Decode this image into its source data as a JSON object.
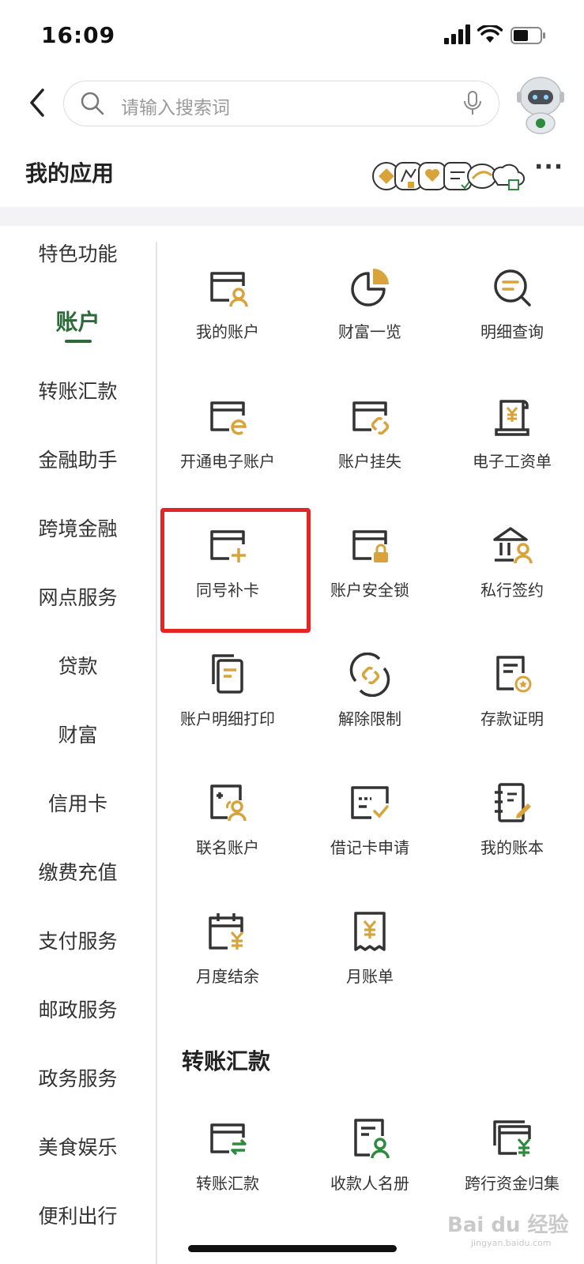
{
  "status_bar": {
    "time": "16:09"
  },
  "search": {
    "placeholder": "请输入搜索词"
  },
  "my_apps": {
    "title": "我的应用",
    "more": "···"
  },
  "sidebar": {
    "items": [
      {
        "label": "特色功能",
        "active": false
      },
      {
        "label": "账户",
        "active": true
      },
      {
        "label": "转账汇款",
        "active": false
      },
      {
        "label": "金融助手",
        "active": false
      },
      {
        "label": "跨境金融",
        "active": false
      },
      {
        "label": "网点服务",
        "active": false
      },
      {
        "label": "贷款",
        "active": false
      },
      {
        "label": "财富",
        "active": false
      },
      {
        "label": "信用卡",
        "active": false
      },
      {
        "label": "缴费充值",
        "active": false
      },
      {
        "label": "支付服务",
        "active": false
      },
      {
        "label": "邮政服务",
        "active": false
      },
      {
        "label": "政务服务",
        "active": false
      },
      {
        "label": "美食娱乐",
        "active": false
      },
      {
        "label": "便利出行",
        "active": false
      }
    ]
  },
  "account_section": {
    "items": [
      {
        "label": "我的账户",
        "icon": "my-account-icon"
      },
      {
        "label": "财富一览",
        "icon": "pie-chart-icon"
      },
      {
        "label": "明细查询",
        "icon": "detail-search-icon"
      },
      {
        "label": "开通电子账户",
        "icon": "e-account-icon"
      },
      {
        "label": "账户挂失",
        "icon": "account-loss-icon"
      },
      {
        "label": "电子工资单",
        "icon": "e-payslip-icon"
      },
      {
        "label": "同号补卡",
        "icon": "card-replace-icon"
      },
      {
        "label": "账户安全锁",
        "icon": "account-lock-icon"
      },
      {
        "label": "私行签约",
        "icon": "private-bank-icon"
      },
      {
        "label": "账户明细打印",
        "icon": "print-detail-icon"
      },
      {
        "label": "解除限制",
        "icon": "unlink-icon"
      },
      {
        "label": "存款证明",
        "icon": "deposit-cert-icon"
      },
      {
        "label": "联名账户",
        "icon": "joint-account-icon"
      },
      {
        "label": "借记卡申请",
        "icon": "debit-card-icon"
      },
      {
        "label": "我的账本",
        "icon": "ledger-icon"
      },
      {
        "label": "月度结余",
        "icon": "calendar-yuan-icon"
      },
      {
        "label": "月账单",
        "icon": "receipt-yuan-icon"
      }
    ]
  },
  "transfer_section": {
    "title": "转账汇款",
    "items": [
      {
        "label": "转账汇款",
        "icon": "transfer-icon"
      },
      {
        "label": "收款人名册",
        "icon": "payee-list-icon"
      },
      {
        "label": "跨行资金归集",
        "icon": "fund-collect-icon"
      }
    ]
  },
  "watermark": {
    "text": "Bai du 经验",
    "sub": "jingyan.baidu.com"
  },
  "colors": {
    "accent_green": "#2d6a3a",
    "icon_gold": "#d9a33b",
    "icon_dark": "#333333",
    "highlight_red": "#e52523"
  }
}
